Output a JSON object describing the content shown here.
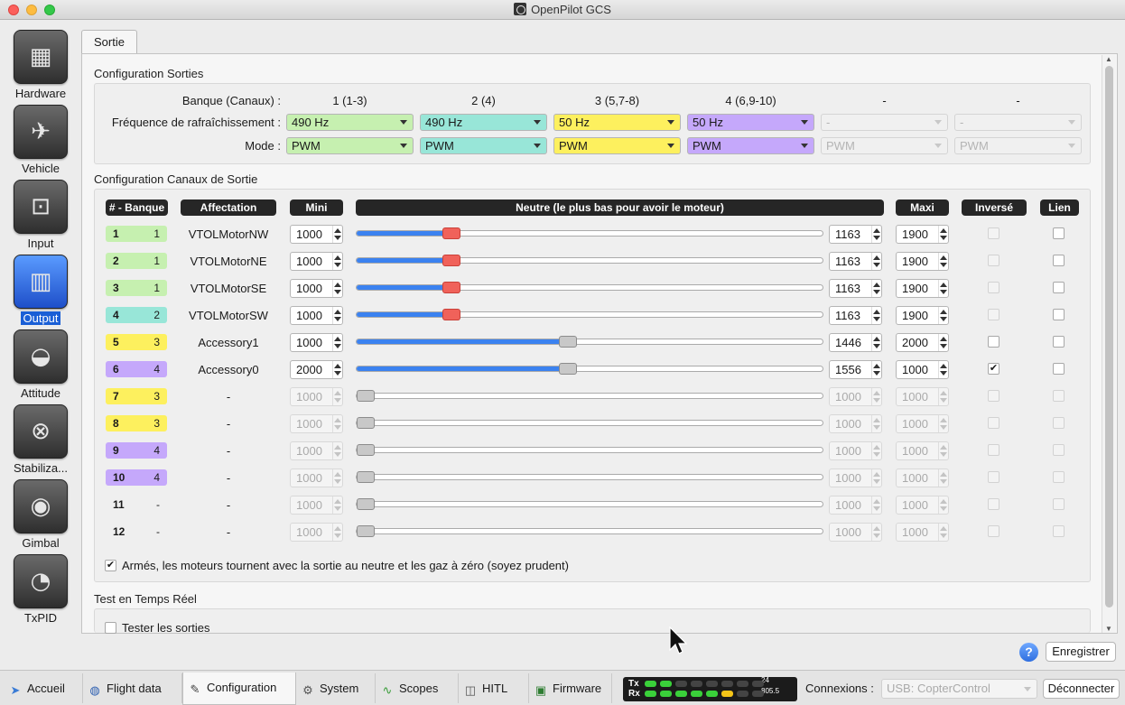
{
  "window": {
    "title": "OpenPilot GCS"
  },
  "sidebar": {
    "items": [
      {
        "label": "Hardware",
        "icon": "chip-icon",
        "active": false
      },
      {
        "label": "Vehicle",
        "icon": "aircraft-icon",
        "active": false
      },
      {
        "label": "Input",
        "icon": "transmitter-icon",
        "active": false
      },
      {
        "label": "Output",
        "icon": "motor-icon",
        "active": true
      },
      {
        "label": "Attitude",
        "icon": "level-icon",
        "active": false
      },
      {
        "label": "Stabiliza...",
        "icon": "gyro-icon",
        "active": false
      },
      {
        "label": "Gimbal",
        "icon": "camera-icon",
        "active": false
      },
      {
        "label": "TxPID",
        "icon": "meter-icon",
        "active": false
      }
    ]
  },
  "tab": {
    "label": "Sortie"
  },
  "output_config": {
    "title": "Configuration Sorties",
    "bank_label": "Banque (Canaux) :",
    "rate_label": "Fréquence de rafraîchissement :",
    "mode_label": "Mode :",
    "banks": [
      {
        "name": "1 (1-3)",
        "rate": "490 Hz",
        "mode": "PWM",
        "color": "#c6f0b0",
        "enabled": true
      },
      {
        "name": "2 (4)",
        "rate": "490 Hz",
        "mode": "PWM",
        "color": "#98e6d8",
        "enabled": true
      },
      {
        "name": "3 (5,7-8)",
        "rate": "50 Hz",
        "mode": "PWM",
        "color": "#fdf05e",
        "enabled": true
      },
      {
        "name": "4 (6,9-10)",
        "rate": "50 Hz",
        "mode": "PWM",
        "color": "#c5a8fb",
        "enabled": true
      },
      {
        "name": "-",
        "rate": "-",
        "mode": "PWM",
        "color": "#f0f0f0",
        "enabled": false
      },
      {
        "name": "-",
        "rate": "-",
        "mode": "PWM",
        "color": "#f0f0f0",
        "enabled": false
      }
    ]
  },
  "channels": {
    "title": "Configuration Canaux de Sortie",
    "headers": {
      "bank": "# - Banque",
      "assignment": "Affectation",
      "min": "Mini",
      "neutral": "Neutre (le plus bas pour avoir le moteur)",
      "max": "Maxi",
      "reversed": "Inversé",
      "link": "Lien"
    },
    "rows": [
      {
        "num": "1",
        "bank": "1",
        "color": "#c6f0b0",
        "assignment": "VTOLMotorNW",
        "min": "1000",
        "neutral": "1163",
        "max": "1900",
        "level": 0.19,
        "motor": true,
        "enabled": true,
        "reversed": false,
        "link": false
      },
      {
        "num": "2",
        "bank": "1",
        "color": "#c6f0b0",
        "assignment": "VTOLMotorNE",
        "min": "1000",
        "neutral": "1163",
        "max": "1900",
        "level": 0.19,
        "motor": true,
        "enabled": true,
        "reversed": false,
        "link": false
      },
      {
        "num": "3",
        "bank": "1",
        "color": "#c6f0b0",
        "assignment": "VTOLMotorSE",
        "min": "1000",
        "neutral": "1163",
        "max": "1900",
        "level": 0.19,
        "motor": true,
        "enabled": true,
        "reversed": false,
        "link": false
      },
      {
        "num": "4",
        "bank": "2",
        "color": "#98e6d8",
        "assignment": "VTOLMotorSW",
        "min": "1000",
        "neutral": "1163",
        "max": "1900",
        "level": 0.19,
        "motor": true,
        "enabled": true,
        "reversed": false,
        "link": false
      },
      {
        "num": "5",
        "bank": "3",
        "color": "#fdf05e",
        "assignment": "Accessory1",
        "min": "1000",
        "neutral": "1446",
        "max": "2000",
        "level": 0.45,
        "motor": false,
        "enabled": true,
        "reversed": false,
        "link": false
      },
      {
        "num": "6",
        "bank": "4",
        "color": "#c5a8fb",
        "assignment": "Accessory0",
        "min": "2000",
        "neutral": "1556",
        "max": "1000",
        "level": 0.45,
        "motor": false,
        "enabled": true,
        "reversed": true,
        "link": false
      },
      {
        "num": "7",
        "bank": "3",
        "color": "#fdf05e",
        "assignment": "-",
        "min": "1000",
        "neutral": "1000",
        "max": "1000",
        "level": 0,
        "motor": false,
        "enabled": false,
        "reversed": false,
        "link": false
      },
      {
        "num": "8",
        "bank": "3",
        "color": "#fdf05e",
        "assignment": "-",
        "min": "1000",
        "neutral": "1000",
        "max": "1000",
        "level": 0,
        "motor": false,
        "enabled": false,
        "reversed": false,
        "link": false
      },
      {
        "num": "9",
        "bank": "4",
        "color": "#c5a8fb",
        "assignment": "-",
        "min": "1000",
        "neutral": "1000",
        "max": "1000",
        "level": 0,
        "motor": false,
        "enabled": false,
        "reversed": false,
        "link": false
      },
      {
        "num": "10",
        "bank": "4",
        "color": "#c5a8fb",
        "assignment": "-",
        "min": "1000",
        "neutral": "1000",
        "max": "1000",
        "level": 0,
        "motor": false,
        "enabled": false,
        "reversed": false,
        "link": false
      },
      {
        "num": "11",
        "bank": "-",
        "color": "#ececec",
        "assignment": "-",
        "min": "1000",
        "neutral": "1000",
        "max": "1000",
        "level": 0,
        "motor": false,
        "enabled": false,
        "reversed": false,
        "link": false
      },
      {
        "num": "12",
        "bank": "-",
        "color": "#ececec",
        "assignment": "-",
        "min": "1000",
        "neutral": "1000",
        "max": "1000",
        "level": 0,
        "motor": false,
        "enabled": false,
        "reversed": false,
        "link": false
      }
    ],
    "armed_label": "Armés, les moteurs tournent avec la sortie au neutre et les gaz à zéro (soyez prudent)",
    "armed_checked": true
  },
  "realtime": {
    "title": "Test en Temps Réel",
    "test_label": "Tester les sorties",
    "test_checked": false
  },
  "actions": {
    "help": "?",
    "save": "Enregistrer"
  },
  "bottom_tabs": [
    {
      "label": "Accueil",
      "icon": "home-icon"
    },
    {
      "label": "Flight data",
      "icon": "globe-icon"
    },
    {
      "label": "Configuration",
      "icon": "wrench-icon",
      "active": true
    },
    {
      "label": "System",
      "icon": "gear-icon"
    },
    {
      "label": "Scopes",
      "icon": "scope-icon"
    },
    {
      "label": "HITL",
      "icon": "gamepad-icon"
    },
    {
      "label": "Firmware",
      "icon": "board-icon"
    }
  ],
  "telemetry": {
    "tx_label": "Tx",
    "rx_label": "Rx",
    "tx_value": "24",
    "rx_value": "805.5",
    "tx_leds": [
      "#3ad13a",
      "#3ad13a",
      "#444",
      "#444",
      "#444",
      "#444",
      "#444",
      "#444"
    ],
    "rx_leds": [
      "#3ad13a",
      "#3ad13a",
      "#3ad13a",
      "#3ad13a",
      "#3ad13a",
      "#f5c518",
      "#444",
      "#444"
    ]
  },
  "connection": {
    "label": "Connexions :",
    "device": "USB: CopterControl",
    "disconnect": "Déconnecter"
  }
}
